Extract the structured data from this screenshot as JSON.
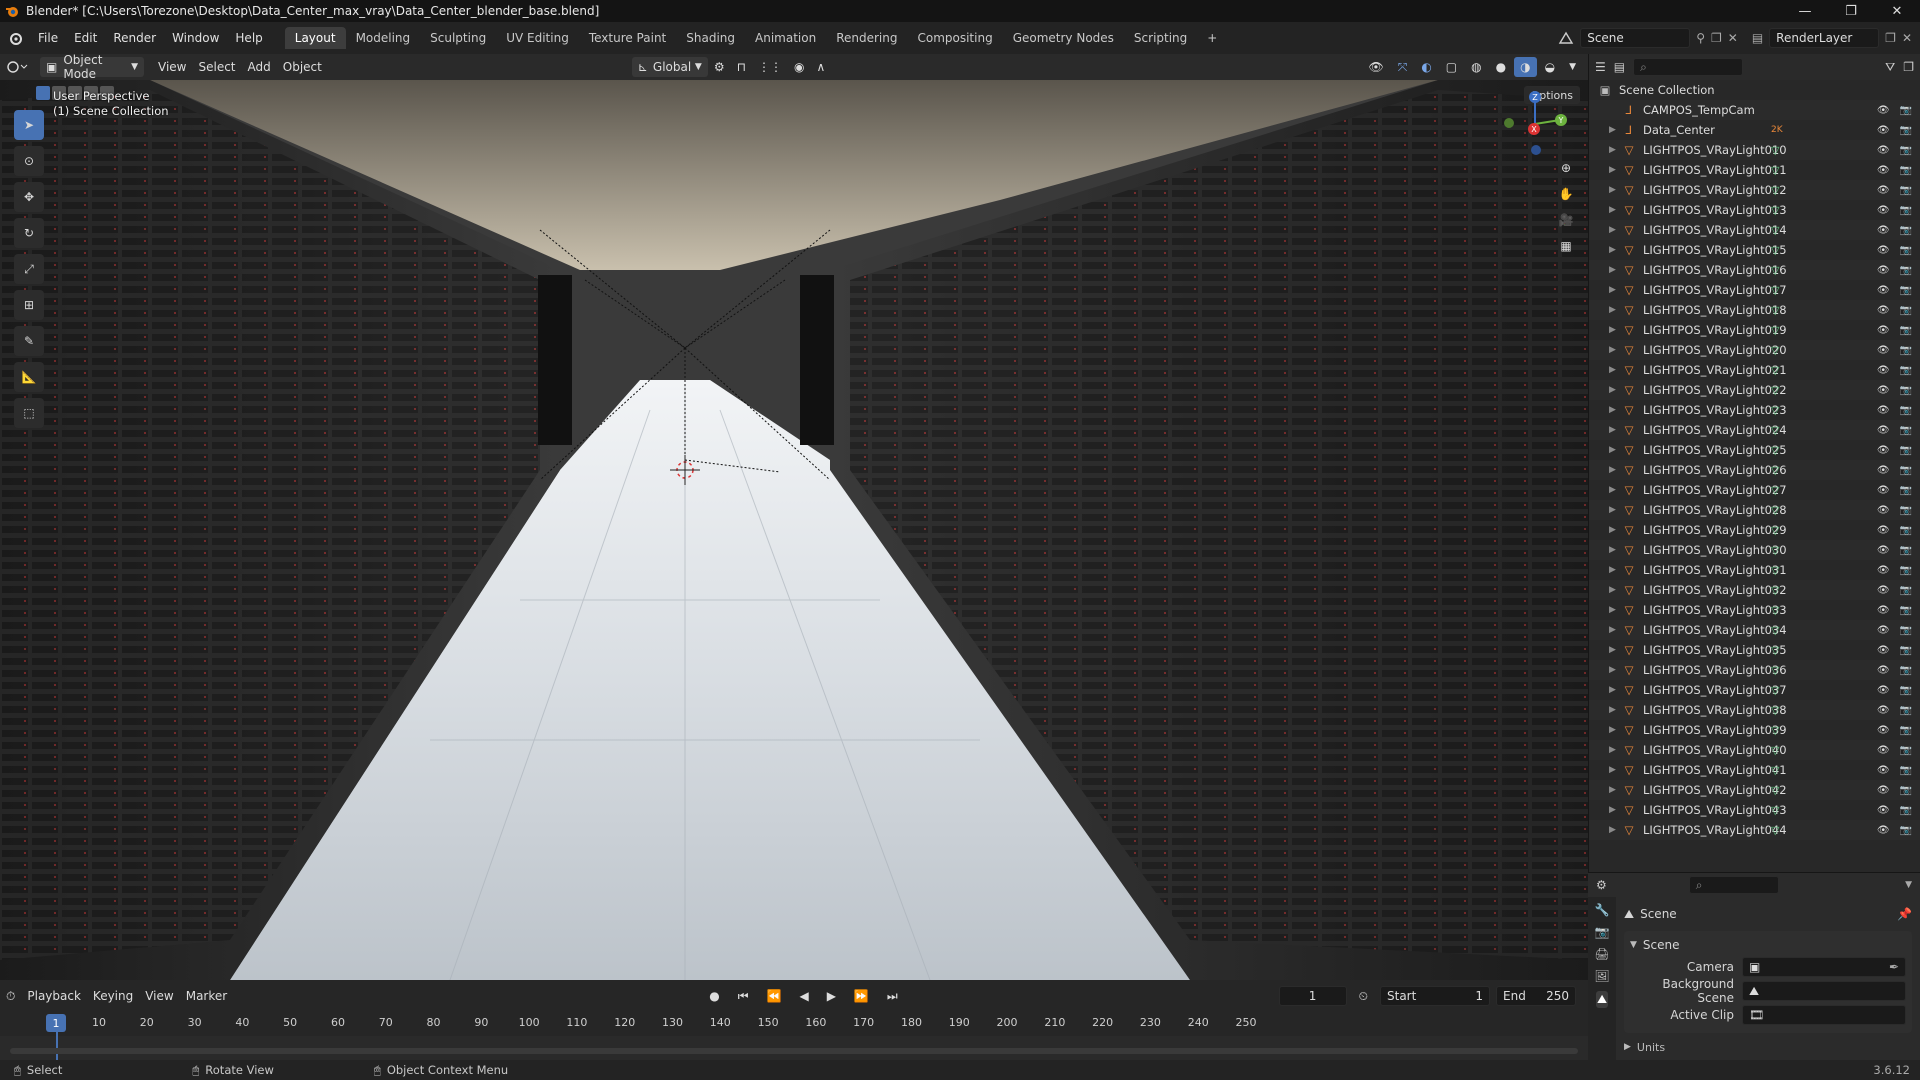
{
  "window": {
    "title": "Blender* [C:\\Users\\Torezone\\Desktop\\Data_Center_max_vray\\Data_Center_blender_base.blend]",
    "controls": [
      "—",
      "❐",
      "✕"
    ]
  },
  "menu": {
    "items": [
      "File",
      "Edit",
      "Render",
      "Window",
      "Help"
    ],
    "workspaces": [
      "Layout",
      "Modeling",
      "Sculpting",
      "UV Editing",
      "Texture Paint",
      "Shading",
      "Animation",
      "Rendering",
      "Compositing",
      "Geometry Nodes",
      "Scripting"
    ],
    "active_workspace": "Layout",
    "add_tab": "+",
    "scene": "Scene",
    "view_layer": "RenderLayer"
  },
  "viewport_header": {
    "mode": "Object Mode",
    "menus": [
      "View",
      "Select",
      "Add",
      "Object"
    ],
    "orientation": "Global",
    "options": "Options"
  },
  "viewport": {
    "perspective": "User Perspective",
    "collection": "(1) Scene Collection",
    "gizmo": {
      "z": "Z",
      "y": "Y",
      "x": "X"
    }
  },
  "outliner": {
    "search_placeholder": "",
    "root": "Scene Collection",
    "items": [
      {
        "name": "CAMPOS_TempCam",
        "type": "empty"
      },
      {
        "name": "Data_Center",
        "type": "empty",
        "badge": "2K"
      },
      {
        "name": "LIGHTPOS_VRayLight010",
        "type": "mesh"
      },
      {
        "name": "LIGHTPOS_VRayLight011",
        "type": "mesh"
      },
      {
        "name": "LIGHTPOS_VRayLight012",
        "type": "mesh"
      },
      {
        "name": "LIGHTPOS_VRayLight013",
        "type": "mesh"
      },
      {
        "name": "LIGHTPOS_VRayLight014",
        "type": "mesh"
      },
      {
        "name": "LIGHTPOS_VRayLight015",
        "type": "mesh"
      },
      {
        "name": "LIGHTPOS_VRayLight016",
        "type": "mesh"
      },
      {
        "name": "LIGHTPOS_VRayLight017",
        "type": "mesh"
      },
      {
        "name": "LIGHTPOS_VRayLight018",
        "type": "mesh"
      },
      {
        "name": "LIGHTPOS_VRayLight019",
        "type": "mesh"
      },
      {
        "name": "LIGHTPOS_VRayLight020",
        "type": "mesh"
      },
      {
        "name": "LIGHTPOS_VRayLight021",
        "type": "mesh"
      },
      {
        "name": "LIGHTPOS_VRayLight022",
        "type": "mesh"
      },
      {
        "name": "LIGHTPOS_VRayLight023",
        "type": "mesh"
      },
      {
        "name": "LIGHTPOS_VRayLight024",
        "type": "mesh"
      },
      {
        "name": "LIGHTPOS_VRayLight025",
        "type": "mesh"
      },
      {
        "name": "LIGHTPOS_VRayLight026",
        "type": "mesh"
      },
      {
        "name": "LIGHTPOS_VRayLight027",
        "type": "mesh"
      },
      {
        "name": "LIGHTPOS_VRayLight028",
        "type": "mesh"
      },
      {
        "name": "LIGHTPOS_VRayLight029",
        "type": "mesh"
      },
      {
        "name": "LIGHTPOS_VRayLight030",
        "type": "mesh"
      },
      {
        "name": "LIGHTPOS_VRayLight031",
        "type": "mesh"
      },
      {
        "name": "LIGHTPOS_VRayLight032",
        "type": "mesh"
      },
      {
        "name": "LIGHTPOS_VRayLight033",
        "type": "mesh"
      },
      {
        "name": "LIGHTPOS_VRayLight034",
        "type": "mesh"
      },
      {
        "name": "LIGHTPOS_VRayLight035",
        "type": "mesh"
      },
      {
        "name": "LIGHTPOS_VRayLight036",
        "type": "mesh"
      },
      {
        "name": "LIGHTPOS_VRayLight037",
        "type": "mesh"
      },
      {
        "name": "LIGHTPOS_VRayLight038",
        "type": "mesh"
      },
      {
        "name": "LIGHTPOS_VRayLight039",
        "type": "mesh"
      },
      {
        "name": "LIGHTPOS_VRayLight040",
        "type": "mesh"
      },
      {
        "name": "LIGHTPOS_VRayLight041",
        "type": "mesh"
      },
      {
        "name": "LIGHTPOS_VRayLight042",
        "type": "mesh"
      },
      {
        "name": "LIGHTPOS_VRayLight043",
        "type": "mesh"
      },
      {
        "name": "LIGHTPOS_VRayLight044",
        "type": "mesh"
      }
    ]
  },
  "properties": {
    "breadcrumb": "Scene",
    "panel": "Scene",
    "fields": [
      {
        "label": "Camera",
        "value": ""
      },
      {
        "label": "Background Scene",
        "value": ""
      },
      {
        "label": "Active Clip",
        "value": ""
      }
    ],
    "collapsed_panel": "Units"
  },
  "timeline": {
    "menus": [
      "Playback",
      "Keying",
      "View",
      "Marker"
    ],
    "current_frame": "1",
    "start_label": "Start",
    "start": "1",
    "end_label": "End",
    "end": "250",
    "ticks": [
      "10",
      "20",
      "30",
      "40",
      "50",
      "60",
      "70",
      "80",
      "90",
      "100",
      "110",
      "120",
      "130",
      "140",
      "150",
      "160",
      "170",
      "180",
      "190",
      "200",
      "210",
      "220",
      "230",
      "240",
      "250"
    ],
    "playhead": "1"
  },
  "statusbar": {
    "hints": [
      "Select",
      "Rotate View",
      "Object Context Menu"
    ],
    "version": "3.6.12"
  },
  "colors": {
    "accent": "#4772b3",
    "mesh_icon": "#e8873a",
    "vertex_green": "#5fbf7f"
  }
}
